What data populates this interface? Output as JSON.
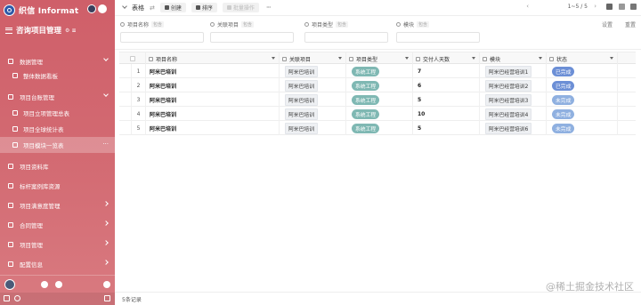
{
  "sidebar": {
    "brand": "织信 Informat",
    "workspace": "咨询项目管理",
    "workspace_icons": "⚙ ≡",
    "items": [
      {
        "label": "数据管理",
        "type": "group",
        "open": true
      },
      {
        "label": "整体数据看板",
        "type": "sub"
      },
      {
        "label": "项目台账管理",
        "type": "group",
        "open": true
      },
      {
        "label": "项目立项管理总表",
        "type": "sub"
      },
      {
        "label": "项目全球统计表",
        "type": "sub"
      },
      {
        "label": "项目模块一览表",
        "type": "sub",
        "active": true
      },
      {
        "label": "项目资料库",
        "type": "item"
      },
      {
        "label": "标杆案例库资源",
        "type": "item"
      },
      {
        "label": "项目满意度管理",
        "type": "item",
        "arrow": true
      },
      {
        "label": "合同管理",
        "type": "item",
        "arrow": true
      },
      {
        "label": "项目管理",
        "type": "item",
        "arrow": true
      },
      {
        "label": "配置信息",
        "type": "item",
        "arrow": true
      }
    ],
    "active_more": "···"
  },
  "toolbar": {
    "title": "表格",
    "switch_icon": "⇄",
    "btn_create": "创建",
    "btn_sort": "排序",
    "btn_batch": "批量操作",
    "more": "···",
    "pager": "1~5 / 5"
  },
  "filters": [
    {
      "label": "项目名称",
      "tag": "包含"
    },
    {
      "label": "关联项目",
      "tag": "包含"
    },
    {
      "label": "项目类型",
      "tag": "包含"
    },
    {
      "label": "模块",
      "tag": "包含"
    }
  ],
  "filter_actions": {
    "settings": "设置",
    "reset": "重置"
  },
  "table": {
    "headers": [
      "项目名称",
      "关联项目",
      "项目类型",
      "交付人天数",
      "模块",
      "状态"
    ],
    "rows": [
      {
        "no": "1",
        "name": "阿米巴培训",
        "project": "阿米巴培训",
        "type": "系统工程",
        "days": "7",
        "module": "阿米巴经营培训1",
        "status": "已完成"
      },
      {
        "no": "2",
        "name": "阿米巴培训",
        "project": "阿米巴培训",
        "type": "系统工程",
        "days": "6",
        "module": "阿米巴经营培训2",
        "status": "已完成"
      },
      {
        "no": "3",
        "name": "阿米巴培训",
        "project": "阿米巴培训",
        "type": "系统工程",
        "days": "5",
        "module": "阿米巴经营培训3",
        "status": "未完成"
      },
      {
        "no": "4",
        "name": "阿米巴培训",
        "project": "阿米巴培训",
        "type": "系统工程",
        "days": "10",
        "module": "阿米巴经营培训4",
        "status": "未完成"
      },
      {
        "no": "5",
        "name": "阿米巴培训",
        "project": "阿米巴培训",
        "type": "系统工程",
        "days": "5",
        "module": "阿米巴经营培训6",
        "status": "未完成"
      }
    ]
  },
  "footer": {
    "count": "5条记录"
  },
  "watermark": "@稀土掘金技术社区",
  "colors": {
    "sidebar": "#d06470",
    "status_done": "#6c8fd6",
    "status_todo": "#8fb0e0",
    "type_tag": "#7fb8b3"
  }
}
